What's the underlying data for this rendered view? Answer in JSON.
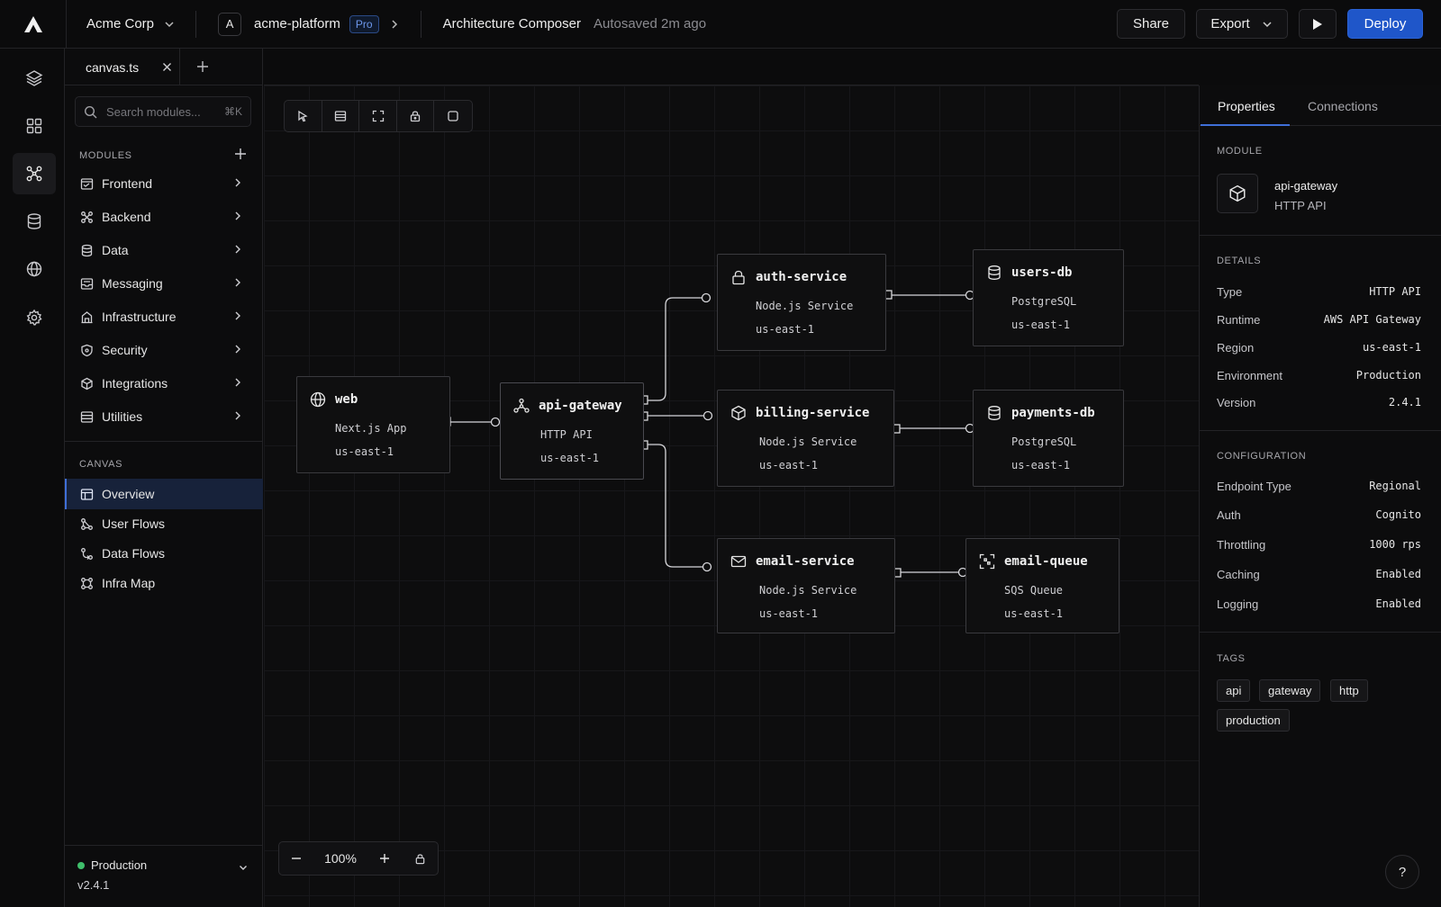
{
  "topbar": {
    "org": "Acme Corp",
    "project_initial": "A",
    "project": "acme-platform",
    "plan": "Pro",
    "page_title": "Architecture Composer",
    "autosave": "Autosaved 2m ago",
    "share_label": "Share",
    "export_label": "Export",
    "deploy_label": "Deploy",
    "accent": "#1f56c9"
  },
  "rail": {
    "icons": [
      "layers-icon",
      "grid-icon",
      "graph-icon",
      "database-icon",
      "globe-icon",
      "settings-icon"
    ],
    "active": "graph-icon"
  },
  "sidebar": {
    "file_tab": "canvas.ts",
    "search_placeholder": "Search modules...",
    "search_shortcut": "⌘K",
    "modules_label": "MODULES",
    "modules": [
      {
        "label": "Frontend",
        "icon": "browser-icon"
      },
      {
        "label": "Backend",
        "icon": "nodes-icon"
      },
      {
        "label": "Data",
        "icon": "database-icon"
      },
      {
        "label": "Messaging",
        "icon": "inbox-icon"
      },
      {
        "label": "Infrastructure",
        "icon": "building-icon"
      },
      {
        "label": "Security",
        "icon": "shield-icon"
      },
      {
        "label": "Integrations",
        "icon": "cube-icon"
      },
      {
        "label": "Utilities",
        "icon": "list-icon"
      }
    ],
    "canvas_label": "CANVAS",
    "canvas_items": [
      {
        "label": "Overview",
        "icon": "overview-icon",
        "active": true
      },
      {
        "label": "User Flows",
        "icon": "flow-icon"
      },
      {
        "label": "Data Flows",
        "icon": "dataflow-icon"
      },
      {
        "label": "Infra Map",
        "icon": "map-icon"
      }
    ],
    "environment": "Production",
    "environment_color": "#3fbf6b",
    "version": "v2.4.1"
  },
  "canvas": {
    "zoom": "100%",
    "nodes": {
      "web": {
        "title": "web",
        "subtitle": "Next.js App",
        "region": "us-east-1",
        "icon": "globe-icon"
      },
      "api_gateway": {
        "title": "api-gateway",
        "subtitle": "HTTP API",
        "region": "us-east-1",
        "icon": "graph-icon"
      },
      "auth_service": {
        "title": "auth-service",
        "subtitle": "Node.js Service",
        "region": "us-east-1",
        "icon": "lock-icon"
      },
      "users_db": {
        "title": "users-db",
        "subtitle": "PostgreSQL",
        "region": "us-east-1",
        "icon": "database-icon"
      },
      "billing_service": {
        "title": "billing-service",
        "subtitle": "Node.js Service",
        "region": "us-east-1",
        "icon": "cube-icon"
      },
      "payments_db": {
        "title": "payments-db",
        "subtitle": "PostgreSQL",
        "region": "us-east-1",
        "icon": "database-icon"
      },
      "email_service": {
        "title": "email-service",
        "subtitle": "Node.js Service",
        "region": "us-east-1",
        "icon": "mail-icon"
      },
      "email_queue": {
        "title": "email-queue",
        "subtitle": "SQS Queue",
        "region": "us-east-1",
        "icon": "queue-icon"
      }
    }
  },
  "panel": {
    "tabs": [
      "Properties",
      "Connections"
    ],
    "module_label": "MODULE",
    "module_name": "api-gateway",
    "module_type": "HTTP API",
    "details_label": "DETAILS",
    "details": [
      {
        "key": "Type",
        "value": "HTTP API"
      },
      {
        "key": "Runtime",
        "value": "AWS API Gateway"
      },
      {
        "key": "Region",
        "value": "us-east-1"
      },
      {
        "key": "Environment",
        "value": "Production"
      },
      {
        "key": "Version",
        "value": "2.4.1"
      }
    ],
    "config_label": "CONFIGURATION",
    "config": [
      {
        "key": "Endpoint Type",
        "value": "Regional"
      },
      {
        "key": "Auth",
        "value": "Cognito"
      },
      {
        "key": "Throttling",
        "value": "1000 rps"
      },
      {
        "key": "Caching",
        "value": "Enabled"
      },
      {
        "key": "Logging",
        "value": "Enabled"
      }
    ],
    "tags_label": "TAGS",
    "tags": [
      "api",
      "gateway",
      "http",
      "production"
    ]
  },
  "help_label": "?"
}
